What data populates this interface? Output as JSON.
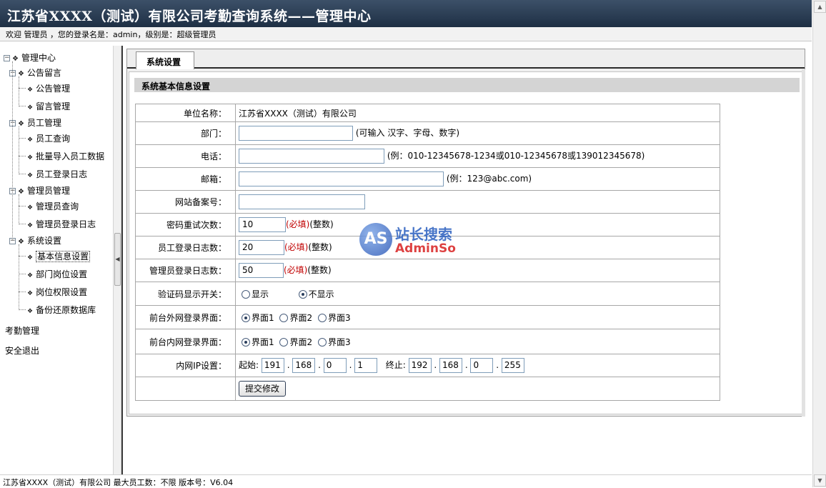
{
  "header": {
    "title": "江苏省XXXX（测试）有限公司考勤查询系统——管理中心",
    "welcome": "欢迎 管理员 ，您的登录名是：admin，级别是：超级管理员"
  },
  "sidebar": {
    "root": "管理中心",
    "groups": [
      {
        "label": "公告留言",
        "items": [
          "公告管理",
          "留言管理"
        ]
      },
      {
        "label": "员工管理",
        "items": [
          "员工查询",
          "批量导入员工数据",
          "员工登录日志"
        ]
      },
      {
        "label": "管理员管理",
        "items": [
          "管理员查询",
          "管理员登录日志"
        ]
      },
      {
        "label": "系统设置",
        "items": [
          "基本信息设置",
          "部门岗位设置",
          "岗位权限设置",
          "备份还原数据库"
        ]
      }
    ],
    "links": [
      "考勤管理",
      "安全退出"
    ]
  },
  "tab": {
    "label": "系统设置"
  },
  "section": {
    "title": "系统基本信息设置"
  },
  "form": {
    "company": {
      "label": "单位名称：",
      "value": "江苏省XXXX（测试）有限公司"
    },
    "dept": {
      "label": "部门：",
      "value": "",
      "hint": "(可输入 汉字、字母、数字)"
    },
    "phone": {
      "label": "电话：",
      "value": "",
      "hint": "(例：010-12345678-1234或010-12345678或13901234567​8)"
    },
    "email": {
      "label": "邮箱：",
      "value": "",
      "hint": "(例：123@abc.com)"
    },
    "icp": {
      "label": "网站备案号：",
      "value": ""
    },
    "retry": {
      "label": "密码重试次数：",
      "value": "10",
      "req": "(必填)",
      "type": "(整数)"
    },
    "emp_log": {
      "label": "员工登录日志数：",
      "value": "20",
      "req": "(必填)",
      "type": "(整数)"
    },
    "admin_log": {
      "label": "管理员登录日志数：",
      "value": "50",
      "req": "(必填)",
      "type": "(整数)"
    },
    "captcha": {
      "label": "验证码显示开关：",
      "options": [
        "显示",
        "不显示"
      ],
      "selected": "不显示"
    },
    "outer_ui": {
      "label": "前台外网登录界面：",
      "options": [
        "界面1",
        "界面2",
        "界面3"
      ],
      "selected": "界面1"
    },
    "inner_ui": {
      "label": "前台内网登录界面：",
      "options": [
        "界面1",
        "界面2",
        "界面3"
      ],
      "selected": "界面1"
    },
    "ip": {
      "label": "内网IP设置：",
      "start_label": "起始:",
      "end_label": "终止:",
      "start": [
        "191",
        "168",
        "0",
        "1"
      ],
      "end": [
        "192",
        "168",
        "0",
        "255"
      ]
    },
    "submit": "提交修改"
  },
  "watermark": {
    "badge": "AS",
    "cn": "站长搜索",
    "en": "AdminSo"
  },
  "footer": {
    "text": "江苏省XXXX（测试）有限公司  最大员工数：不限  版本号：V6.04"
  }
}
